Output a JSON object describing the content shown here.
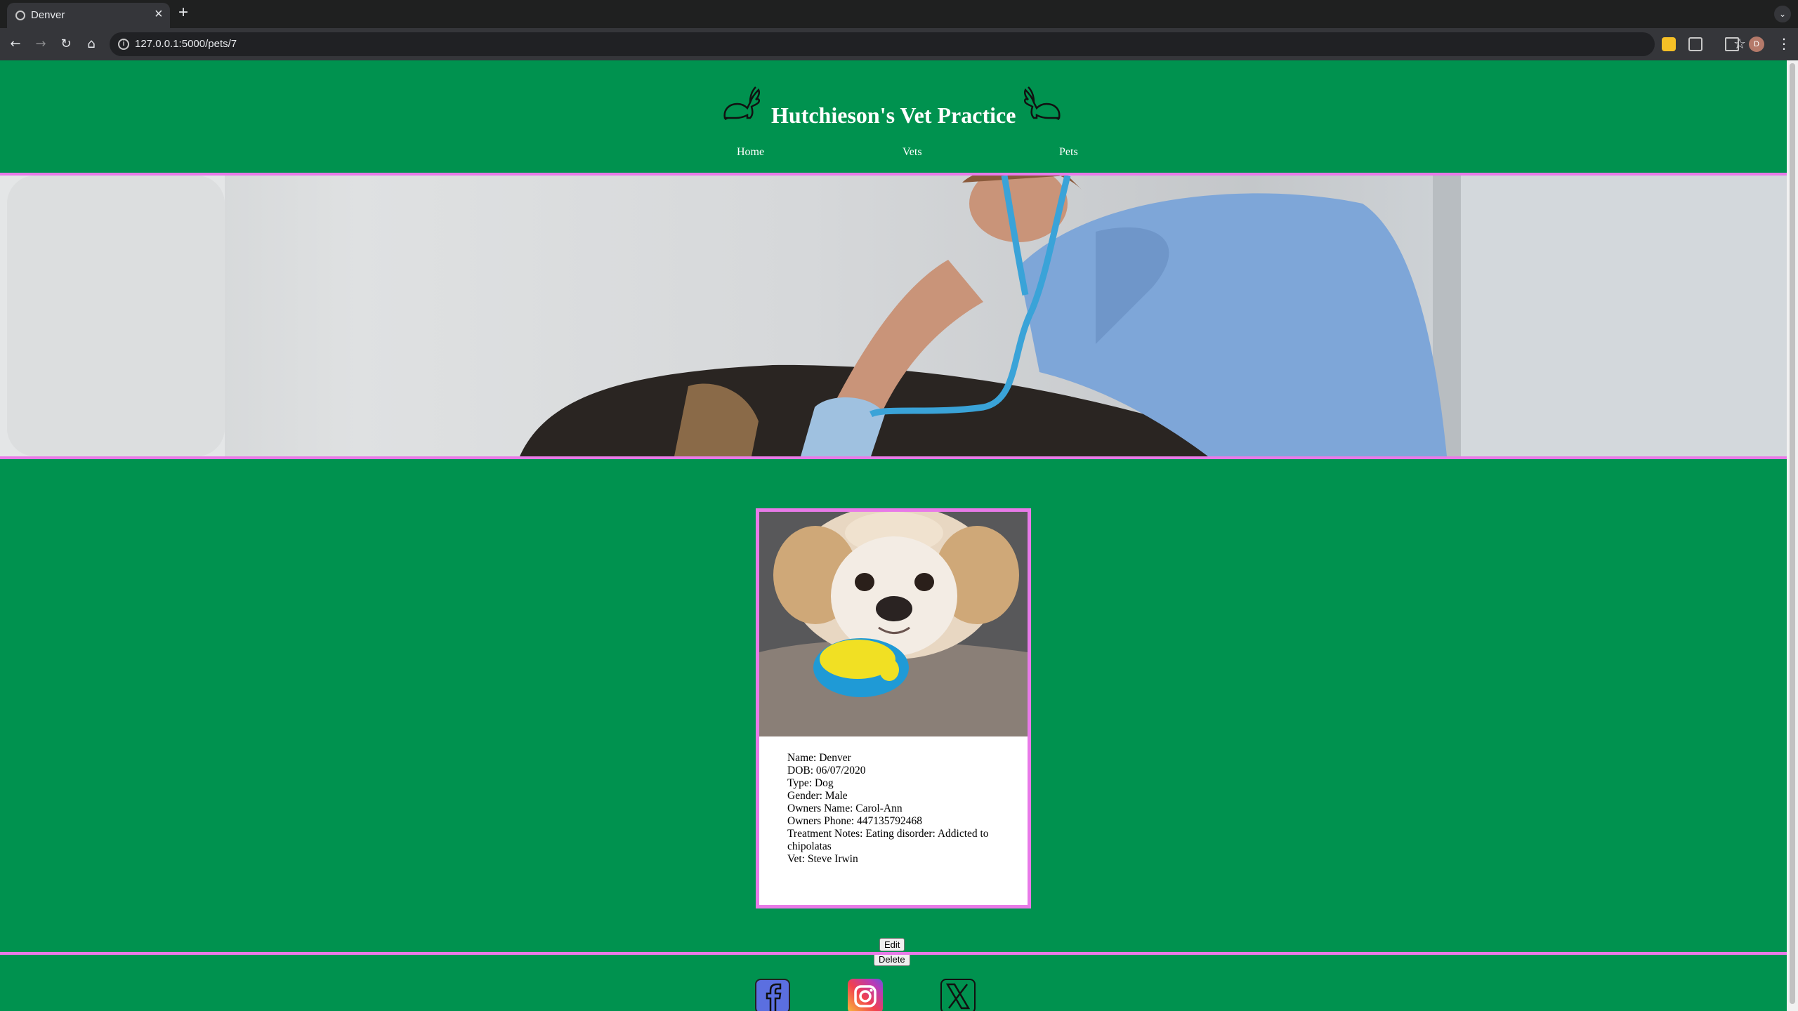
{
  "browser": {
    "tab_title": "Denver",
    "tab_close": "×",
    "new_tab": "+",
    "url": "127.0.0.1:5000/pets/7",
    "avatar_initial": "D"
  },
  "site": {
    "title": "Hutchieson's Vet Practice",
    "nav": [
      "Home",
      "Vets",
      "Pets"
    ],
    "accent_color": "#e87ae8",
    "background_color": "#00924f"
  },
  "pet": {
    "name": "Name: Denver",
    "dob": "DOB: 06/07/2020",
    "type": "Type: Dog",
    "gender": "Gender: Male",
    "owner_name": "Owners Name: Carol-Ann",
    "owner_phone": "Owners Phone: 447135792468",
    "treatment_notes": "Treatment Notes: Eating disorder: Addicted to chipolatas",
    "vet": "Vet: Steve Irwin",
    "edit_label": "Edit",
    "delete_label": "Delete"
  },
  "social": [
    "facebook-icon",
    "instagram-icon",
    "x-icon"
  ]
}
